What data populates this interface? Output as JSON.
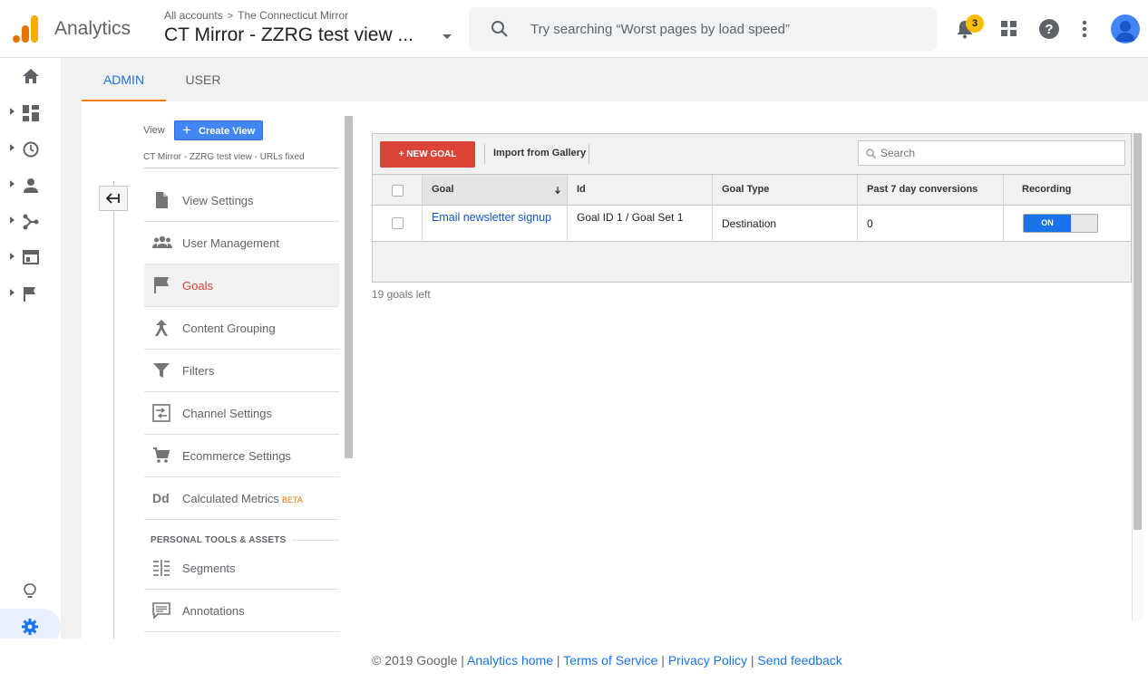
{
  "header": {
    "app_name": "Analytics",
    "breadcrumb": {
      "account": "All accounts",
      "sep": ">",
      "property": "The Connecticut Mirror"
    },
    "view_name": "CT Mirror - ZZRG test view ...",
    "search_placeholder": "Try searching “Worst pages by load speed”",
    "notifications_count": "3"
  },
  "left_nav": {
    "items": [
      "home-icon",
      "customization-icon",
      "realtime-icon",
      "audience-icon",
      "acquisition-icon",
      "behavior-icon",
      "conversions-icon"
    ],
    "bottom": [
      "discover-icon",
      "admin-gear-icon",
      "expand-icon"
    ]
  },
  "tabs": {
    "admin": "ADMIN",
    "user": "USER"
  },
  "admin": {
    "view_label": "View",
    "create_view": "Create View",
    "view_selector": "CT Mirror - ZZRG test view - URLs fixed",
    "menu": [
      {
        "label": "View Settings"
      },
      {
        "label": "User Management"
      },
      {
        "label": "Goals"
      },
      {
        "label": "Content Grouping"
      },
      {
        "label": "Filters"
      },
      {
        "label": "Channel Settings"
      },
      {
        "label": "Ecommerce Settings"
      },
      {
        "label": "Calculated Metrics",
        "badge": "BETA"
      }
    ],
    "personal_header": "PERSONAL TOOLS & ASSETS",
    "personal": [
      {
        "label": "Segments"
      },
      {
        "label": "Annotations"
      }
    ]
  },
  "goals": {
    "new_goal": "+ NEW GOAL",
    "import": "Import from Gallery",
    "search_placeholder": "Search",
    "columns": [
      "Goal",
      "Id",
      "Goal Type",
      "Past 7 day conversions",
      "Recording"
    ],
    "rows": [
      {
        "goal": "Email newsletter signup",
        "id": "Goal ID 1 / Goal Set 1",
        "type": "Destination",
        "conversions": "0",
        "recording": "ON"
      }
    ],
    "remaining": "19 goals left"
  },
  "footer": {
    "copyright": "© 2019 Google |",
    "links": [
      "Analytics home",
      "Terms of Service",
      "Privacy Policy",
      "Send feedback"
    ],
    "sep": "|"
  },
  "colors": {
    "accent": "#1a73e8",
    "new_goal": "#db4437",
    "active_tab_underline": "#f57c00",
    "badge": "#fbbc04"
  }
}
